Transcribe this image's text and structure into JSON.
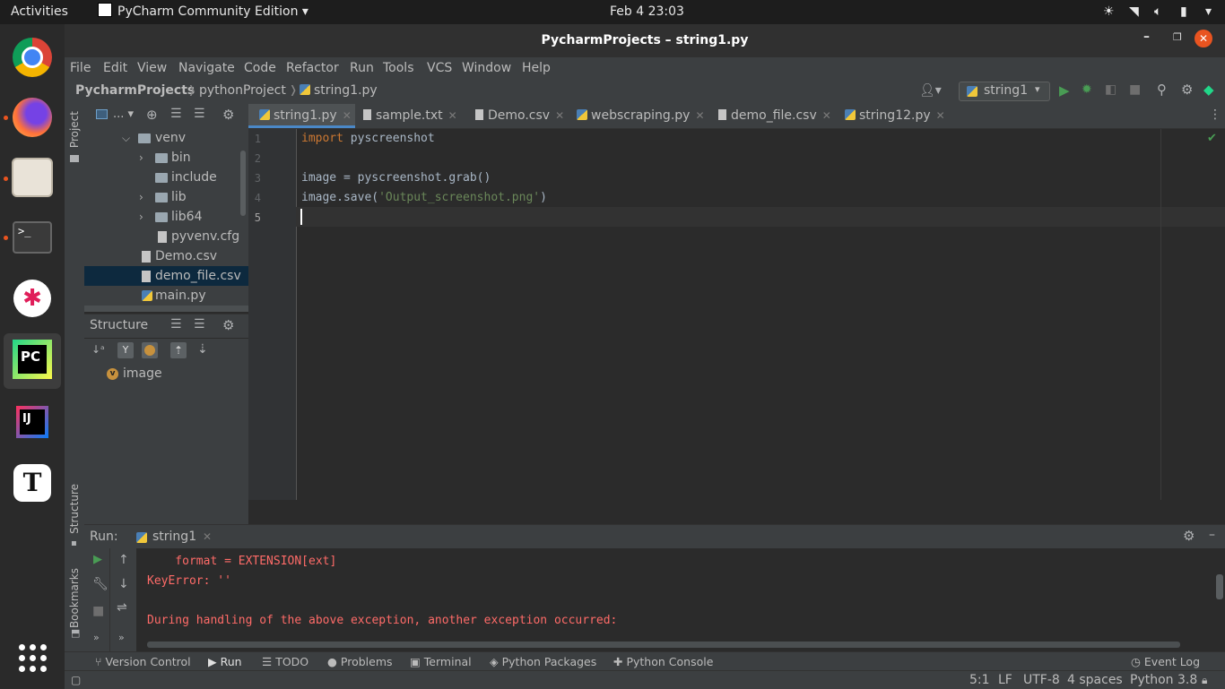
{
  "topbar": {
    "activities": "Activities",
    "app_menu": "PyCharm Community Edition",
    "clock": "Feb 4  23:03"
  },
  "window": {
    "title": "PycharmProjects – string1.py"
  },
  "menu": [
    "File",
    "Edit",
    "View",
    "Navigate",
    "Code",
    "Refactor",
    "Run",
    "Tools",
    "VCS",
    "Window",
    "Help"
  ],
  "breadcrumb": {
    "root": "PycharmProjects",
    "folder": "pythonProject",
    "file": "string1.py"
  },
  "run_config": "string1",
  "project_panel": {
    "label": "Project",
    "header_label": "...",
    "tree": [
      {
        "name": "venv",
        "type": "folder",
        "expanded": true
      },
      {
        "name": "bin",
        "type": "folder"
      },
      {
        "name": "include",
        "type": "folder"
      },
      {
        "name": "lib",
        "type": "folder"
      },
      {
        "name": "lib64",
        "type": "folder"
      },
      {
        "name": "pyvenv.cfg",
        "type": "file"
      },
      {
        "name": "Demo.csv",
        "type": "file"
      },
      {
        "name": "demo_file.csv",
        "type": "file",
        "selected": true
      },
      {
        "name": "main.py",
        "type": "python"
      }
    ]
  },
  "structure_panel": {
    "title": "Structure",
    "items": [
      {
        "badge": "v",
        "name": "image"
      }
    ],
    "side_label": "Structure"
  },
  "tabs": [
    {
      "label": "string1.py",
      "icon": "python-icon",
      "active": true
    },
    {
      "label": "sample.txt",
      "icon": "text-file-icon"
    },
    {
      "label": "Demo.csv",
      "icon": "text-file-icon"
    },
    {
      "label": "webscraping.py",
      "icon": "python-icon"
    },
    {
      "label": "demo_file.csv",
      "icon": "text-file-icon"
    },
    {
      "label": "string12.py",
      "icon": "python-icon"
    }
  ],
  "editor": {
    "line_numbers": [
      "1",
      "2",
      "3",
      "4",
      "5"
    ],
    "lines": {
      "l1_kw": "import",
      "l1_rest": " pyscreenshot",
      "l3": "image = pyscreenshot.grab()",
      "l4_a": "image.save(",
      "l4_str": "'Output_screenshot.png'",
      "l4_b": ")"
    }
  },
  "run_panel": {
    "label": "Run:",
    "tab": "string1",
    "output": [
      "    format = EXTENSION[ext]",
      "KeyError: ''",
      "",
      "During handling of the above exception, another exception occurred:"
    ],
    "side_label": "Bookmarks"
  },
  "tool_tabs": [
    "Version Control",
    "Run",
    "TODO",
    "Problems",
    "Terminal",
    "Python Packages",
    "Python Console"
  ],
  "event_log": "Event Log",
  "status": {
    "position": "5:1",
    "line_sep": "LF",
    "encoding": "UTF-8",
    "indent": "4 spaces",
    "interpreter": "Python 3.8"
  },
  "colors": {
    "accent": "#4a88c7",
    "error_text": "#ff6b68",
    "keyword": "#cc7832",
    "string": "#6a8759"
  }
}
